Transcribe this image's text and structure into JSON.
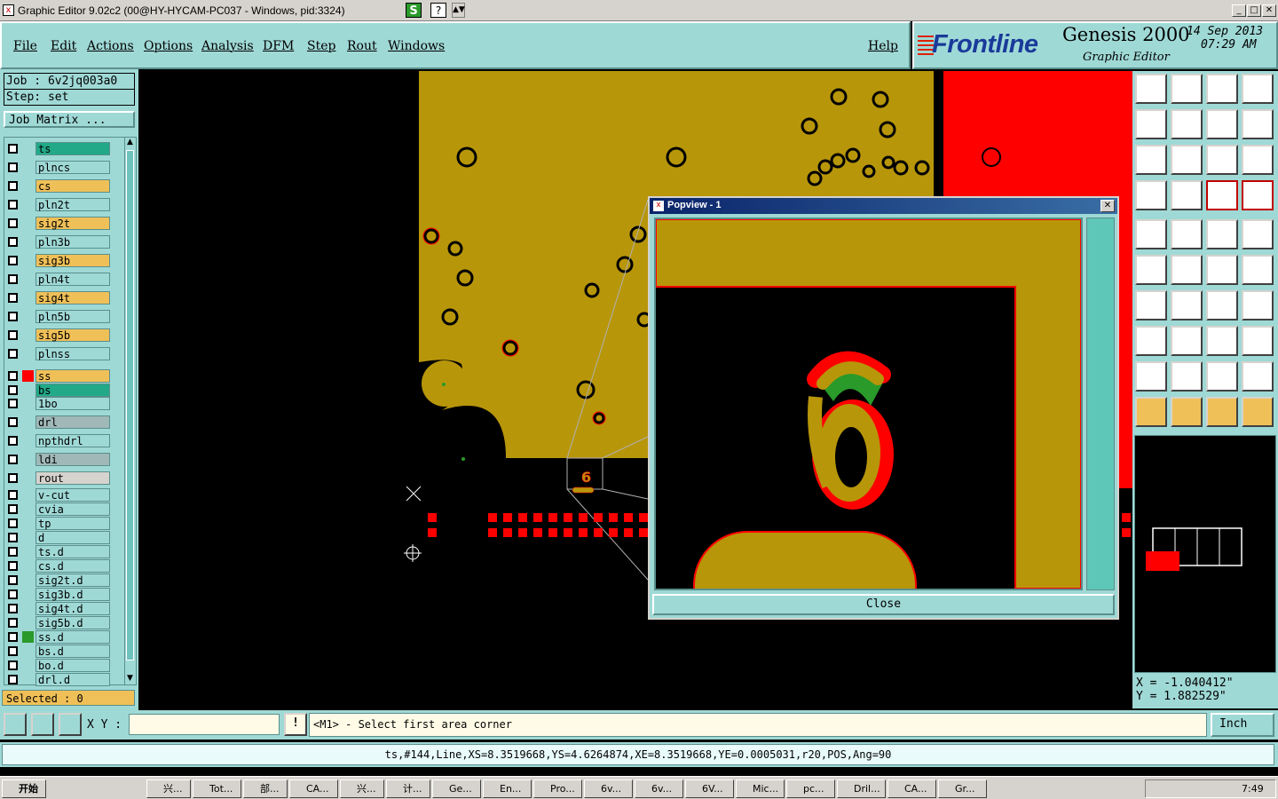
{
  "window": {
    "title": "Graphic Editor 9.02c2 (00@HY-HYCAM-PC037 - Windows, pid:3324)"
  },
  "menu": {
    "items": [
      "File",
      "Edit",
      "Actions",
      "Options",
      "Analysis",
      "DFM",
      "Step",
      "Rout",
      "Windows"
    ],
    "help": "Help"
  },
  "brand": {
    "logo": "Frontline",
    "product": "Genesis 2000",
    "subtitle": "Graphic Editor",
    "date": "14 Sep 2013",
    "time": "07:29 AM"
  },
  "job": {
    "job_line": "Job : 6v2jq003a0",
    "step_line": "Step: set",
    "matrix_button": "Job Matrix ..."
  },
  "layers": [
    {
      "name": "ts",
      "color": "#22aa88"
    },
    {
      "name": "plncs",
      "color": "#9fd9d6"
    },
    {
      "name": "cs",
      "color": "#f0c058"
    },
    {
      "name": "pln2t",
      "color": "#9fd9d6"
    },
    {
      "name": "sig2t",
      "color": "#f0c058"
    },
    {
      "name": "pln3b",
      "color": "#9fd9d6"
    },
    {
      "name": "sig3b",
      "color": "#f0c058"
    },
    {
      "name": "pln4t",
      "color": "#9fd9d6"
    },
    {
      "name": "sig4t",
      "color": "#f0c058"
    },
    {
      "name": "pln5b",
      "color": "#9fd9d6"
    },
    {
      "name": "sig5b",
      "color": "#f0c058"
    },
    {
      "name": "plnss",
      "color": "#9fd9d6"
    },
    {
      "name": "ss",
      "color": "#f0c058",
      "swatch": "#ff0000"
    },
    {
      "name": "bs",
      "color": "#22aa88"
    },
    {
      "name": "1bo",
      "color": "#9fd9d6"
    },
    {
      "name": "drl",
      "color": "#a0b8b8"
    },
    {
      "name": "npthdrl",
      "color": "#9fd9d6"
    },
    {
      "name": "ldi",
      "color": "#a0b8b8"
    },
    {
      "name": "rout",
      "color": "#d6d3ce"
    },
    {
      "name": "v-cut",
      "color": "#9fd9d6"
    },
    {
      "name": "cvia",
      "color": "#9fd9d6"
    },
    {
      "name": "tp",
      "color": "#9fd9d6"
    },
    {
      "name": "d",
      "color": "#9fd9d6"
    },
    {
      "name": "ts.d",
      "color": "#9fd9d6"
    },
    {
      "name": "cs.d",
      "color": "#9fd9d6"
    },
    {
      "name": "sig2t.d",
      "color": "#9fd9d6"
    },
    {
      "name": "sig3b.d",
      "color": "#9fd9d6"
    },
    {
      "name": "sig4t.d",
      "color": "#9fd9d6"
    },
    {
      "name": "sig5b.d",
      "color": "#9fd9d6"
    },
    {
      "name": "ss.d",
      "color": "#9fd9d6",
      "swatch": "#2a9a2a"
    },
    {
      "name": "bs.d",
      "color": "#9fd9d6"
    },
    {
      "name": "bo.d",
      "color": "#9fd9d6"
    },
    {
      "name": "drl.d",
      "color": "#9fd9d6"
    }
  ],
  "selected": "Selected : 0",
  "popview": {
    "title": "Popview - 1",
    "close": "Close",
    "zoomed_text": "6"
  },
  "coords": {
    "x": "X = -1.040412\"",
    "y": "Y = 1.882529\""
  },
  "command": {
    "xy_label": "X Y :",
    "xy_value": "",
    "prompt": "<M1> - Select first area corner",
    "units": "Inch"
  },
  "status": "ts,#144,Line,XS=8.3519668,YS=4.6264874,XE=8.3519668,YE=0.0005031,r20,POS,Ang=90",
  "taskbar": {
    "start": "开始",
    "items": [
      "兴...",
      "Tot...",
      "部...",
      "CA...",
      "兴...",
      "计...",
      "Ge...",
      "En...",
      "Pro...",
      "6v...",
      "6v...",
      "6V...",
      "Mic...",
      "pc...",
      "Dril...",
      "CA...",
      "Gr..."
    ],
    "clock": "7:49"
  },
  "colors": {
    "copper": "#b8960a",
    "mask": "#ff0000",
    "panel": "#9fd9d6"
  }
}
